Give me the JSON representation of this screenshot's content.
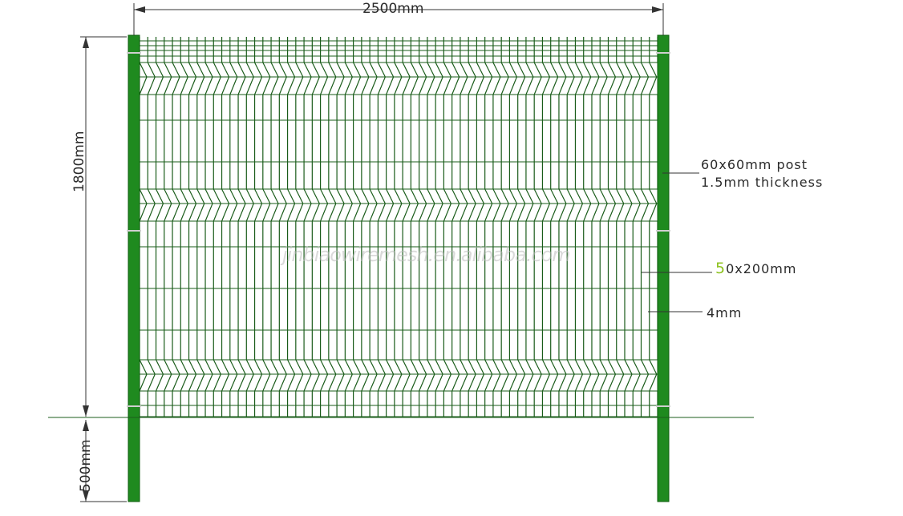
{
  "dimensions": {
    "width": "2500mm",
    "height": "1800mm",
    "depth": "500mm"
  },
  "callouts": {
    "post_line1": "60x60mm post",
    "post_line2": "1.5mm thickness",
    "mesh_first": "5",
    "mesh_rest": "0x200mm",
    "wire": "4mm"
  },
  "watermark": "jinbiaowiremesh.en.alibaba.com",
  "colors": {
    "post": "#1f8a1f",
    "post_dark": "#0f5e0f",
    "wire": "#1a5c1a",
    "dimension": "#333333"
  }
}
